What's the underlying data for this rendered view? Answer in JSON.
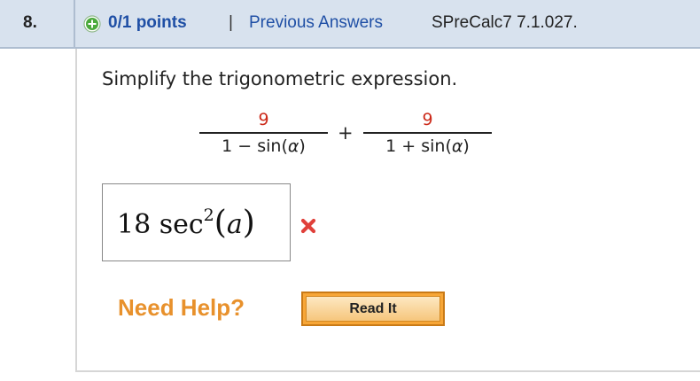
{
  "header": {
    "question_number": "8.",
    "points": "0/1 points",
    "separator": "|",
    "previous_answers_link": "Previous Answers",
    "problem_code": "SPreCalc7 7.1.027."
  },
  "question": {
    "prompt": "Simplify the trigonometric expression.",
    "expression": {
      "fraction1": {
        "numerator": "9",
        "denominator_prefix": "1 − sin(",
        "variable": "α",
        "denominator_suffix": ")"
      },
      "operator": "+",
      "fraction2": {
        "numerator": "9",
        "denominator_prefix": "1 + sin(",
        "variable": "α",
        "denominator_suffix": ")"
      }
    }
  },
  "answer": {
    "coefficient": "18 sec",
    "exponent": "2",
    "open_paren": "(",
    "variable": "a",
    "close_paren": ")",
    "status": "incorrect"
  },
  "help": {
    "label": "Need Help?",
    "read_it_button": "Read It"
  },
  "colors": {
    "header_bg": "#d8e2ee",
    "link_blue": "#1f4fa5",
    "numerator_red": "#cc2a1a",
    "help_orange": "#e8912c",
    "incorrect_red": "#e0403a",
    "points_icon_green": "#4caa3c"
  },
  "icons": {
    "points": "plus-circle-icon",
    "incorrect": "x-mark-icon"
  }
}
